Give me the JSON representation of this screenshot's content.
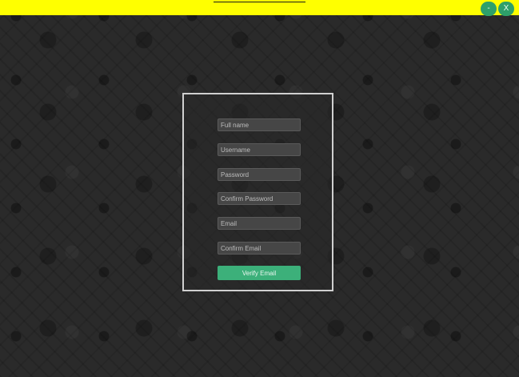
{
  "window": {
    "minimize_label": "-",
    "close_label": "X",
    "accent_color": "#ffff00",
    "button_color": "#2ea06a"
  },
  "form": {
    "full_name_placeholder": "Full name",
    "username_placeholder": "Username",
    "password_placeholder": "Password",
    "confirm_password_placeholder": "Confirm Password",
    "email_placeholder": "Email",
    "confirm_email_placeholder": "Confirm Email",
    "verify_label": "Verify Email",
    "verify_color": "#3cb07a"
  }
}
